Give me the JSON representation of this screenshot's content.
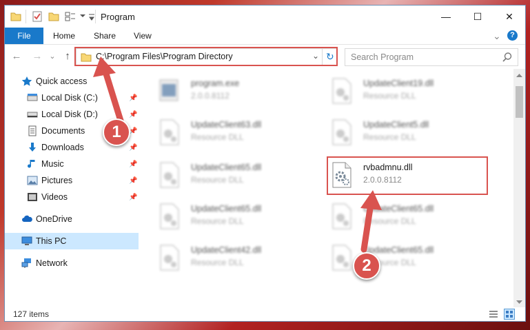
{
  "window": {
    "title": "Program",
    "controls": {
      "minimize": "—",
      "maximize": "☐",
      "close": "✕"
    }
  },
  "ribbon": {
    "tabs": [
      {
        "label": "File"
      },
      {
        "label": "Home"
      },
      {
        "label": "Share"
      },
      {
        "label": "View"
      }
    ],
    "help": "?",
    "expand": "⌄"
  },
  "navigation": {
    "back": "←",
    "forward": "→",
    "recent": "⌄",
    "up": "↑"
  },
  "address": {
    "path": "C:\\Program Files\\Program Directory",
    "dropdown": "⌄",
    "refresh": "↻"
  },
  "search": {
    "placeholder": "Search Program",
    "icon": "search-icon"
  },
  "sidebar": {
    "items": [
      {
        "label": "Quick access",
        "icon": "star-icon",
        "pinned": false
      },
      {
        "label": "Local Disk (C:)",
        "icon": "drive-icon",
        "pinned": true
      },
      {
        "label": "Local Disk (D:)",
        "icon": "drive-icon",
        "pinned": true
      },
      {
        "label": "Documents",
        "icon": "documents-icon",
        "pinned": true
      },
      {
        "label": "Downloads",
        "icon": "download-icon",
        "pinned": true
      },
      {
        "label": "Music",
        "icon": "music-icon",
        "pinned": true
      },
      {
        "label": "Pictures",
        "icon": "pictures-icon",
        "pinned": true
      },
      {
        "label": "Videos",
        "icon": "video-icon",
        "pinned": true
      },
      {
        "label": "OneDrive",
        "icon": "cloud-icon",
        "pinned": false
      },
      {
        "label": "This PC",
        "icon": "computer-icon",
        "pinned": false,
        "selected": true
      },
      {
        "label": "Network",
        "icon": "network-icon",
        "pinned": false
      }
    ],
    "pin_glyph": "📌"
  },
  "files": [
    {
      "name": "program.exe",
      "sub": "2.0.0.8112",
      "blurred": true,
      "kind": "exe"
    },
    {
      "name": "UpdateClient19.dll",
      "sub": "Resource DLL",
      "blurred": true,
      "kind": "dll"
    },
    {
      "name": "UpdateClient63.dll",
      "sub": "Resource DLL",
      "blurred": true,
      "kind": "dll"
    },
    {
      "name": "UpdateClient5.dll",
      "sub": "Resource DLL",
      "blurred": true,
      "kind": "dll"
    },
    {
      "name": "UpdateClient65.dll",
      "sub": "Resource DLL",
      "blurred": true,
      "kind": "dll"
    },
    {
      "name": "rvbadmnu.dll",
      "sub": "2.0.0.8112",
      "blurred": false,
      "kind": "dll"
    },
    {
      "name": "UpdateClient65.dll",
      "sub": "Resource DLL",
      "blurred": true,
      "kind": "dll"
    },
    {
      "name": "UpdateClient65.dll",
      "sub": "Resource DLL",
      "blurred": true,
      "kind": "dll"
    },
    {
      "name": "UpdateClient42.dll",
      "sub": "Resource DLL",
      "blurred": true,
      "kind": "dll"
    },
    {
      "name": "UpdateClient65.dll",
      "sub": "Resource DLL",
      "blurred": true,
      "kind": "dll"
    }
  ],
  "status": {
    "count": "127 items"
  },
  "annotations": {
    "step1": "1",
    "step2": "2",
    "highlight_color": "#d9534f"
  },
  "colors": {
    "accent": "#1979ca",
    "selected_bg": "#cce8ff",
    "folder": "#f8d775"
  }
}
